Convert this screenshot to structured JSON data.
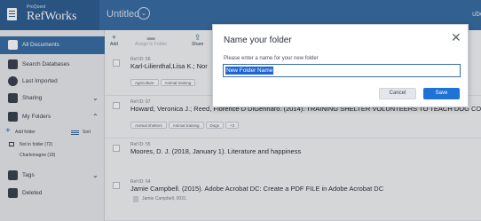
{
  "app": {
    "logo_small": "ProQuest",
    "logo_name": "RefWorks",
    "document_title": "Untitled",
    "top_right_partial": "ube"
  },
  "toolbar": {
    "add_label": "Add",
    "assign_label": "Assign to Folder",
    "share_label": "Share"
  },
  "sidebar": {
    "all_documents": "All Documents",
    "search_databases": "Search Databases",
    "last_imported": "Last Imported",
    "sharing": "Sharing",
    "my_folders": "My Folders",
    "add_folder": "Add folder",
    "sort": "Sort",
    "not_in_folder": "Not in folder (72)",
    "folder_charlemagne": "Charlemagne (18)",
    "tags": "Tags",
    "deleted": "Deleted"
  },
  "references": [
    {
      "id": "Ref ID: 56",
      "title": "Karl-Lilienthal,Lisa K.; Nor",
      "tags": [
        "Agriculture",
        "Animal training"
      ],
      "attachment": ""
    },
    {
      "id": "Ref ID: 97",
      "title": "Howard, Veronica J.; Reed, Florence D DiGennaro. (2014). TRAINING SHELTER VOLUNTEERS TO TEACH DOG COM",
      "tags": [
        "Animal shelters",
        "Animal training",
        "Dogs",
        "+3"
      ],
      "attachment": ""
    },
    {
      "id": "Ref ID: 55",
      "title": "Moores, D. J. (2018, January 1). Literature and happiness",
      "tags": [],
      "attachment": ""
    },
    {
      "id": "Ref ID: 64",
      "title": "Jamie Campbell. (2015). Adobe Acrobat DC: Create a PDF FILE in Adobe Acrobat DC",
      "tags": [],
      "attachment": "Jamie Campbell, 0031"
    }
  ],
  "modal": {
    "title": "Name your folder",
    "close_glyph": "✕",
    "prompt": "Please enter a name for your new folder",
    "input_value": "New Folder Name",
    "cancel_label": "Cancel",
    "save_label": "Save"
  },
  "colors": {
    "brand_blue": "#3a6ea5",
    "primary_button": "#1f73d6",
    "selection": "#1f63d6"
  },
  "icons": {
    "title_chevron": "⌄",
    "expand": "⌄",
    "collapse": "⌃",
    "add": "+",
    "share": "⇪"
  }
}
